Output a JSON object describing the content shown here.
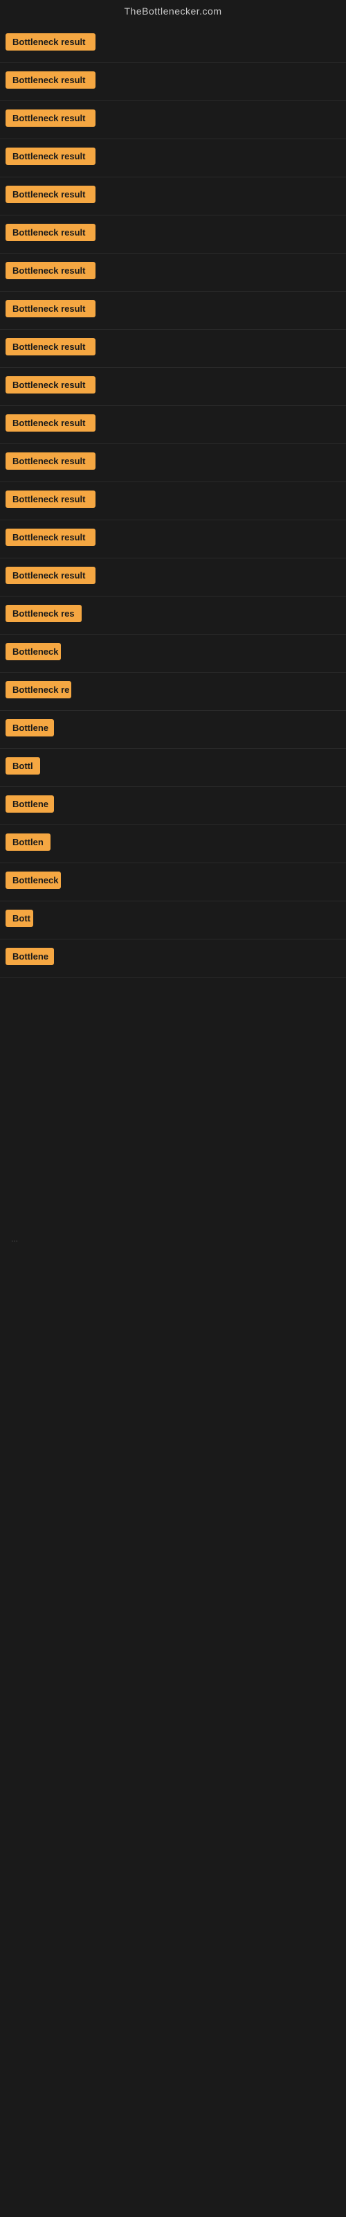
{
  "header": {
    "title": "TheBottlenecker.com"
  },
  "badge_color": "#f5a742",
  "results": [
    {
      "label": "Bottleneck result",
      "width": 130
    },
    {
      "label": "Bottleneck result",
      "width": 130
    },
    {
      "label": "Bottleneck result",
      "width": 130
    },
    {
      "label": "Bottleneck result",
      "width": 130
    },
    {
      "label": "Bottleneck result",
      "width": 130
    },
    {
      "label": "Bottleneck result",
      "width": 130
    },
    {
      "label": "Bottleneck result",
      "width": 130
    },
    {
      "label": "Bottleneck result",
      "width": 130
    },
    {
      "label": "Bottleneck result",
      "width": 130
    },
    {
      "label": "Bottleneck result",
      "width": 130
    },
    {
      "label": "Bottleneck result",
      "width": 130
    },
    {
      "label": "Bottleneck result",
      "width": 130
    },
    {
      "label": "Bottleneck result",
      "width": 130
    },
    {
      "label": "Bottleneck result",
      "width": 130
    },
    {
      "label": "Bottleneck result",
      "width": 130
    },
    {
      "label": "Bottleneck res",
      "width": 110
    },
    {
      "label": "Bottleneck",
      "width": 80
    },
    {
      "label": "Bottleneck re",
      "width": 95
    },
    {
      "label": "Bottlene",
      "width": 70
    },
    {
      "label": "Bottl",
      "width": 50
    },
    {
      "label": "Bottlene",
      "width": 70
    },
    {
      "label": "Bottlen",
      "width": 65
    },
    {
      "label": "Bottleneck",
      "width": 80
    },
    {
      "label": "Bott",
      "width": 40
    },
    {
      "label": "Bottlene",
      "width": 70
    }
  ],
  "ellipsis": "...",
  "empty_rows": 8
}
